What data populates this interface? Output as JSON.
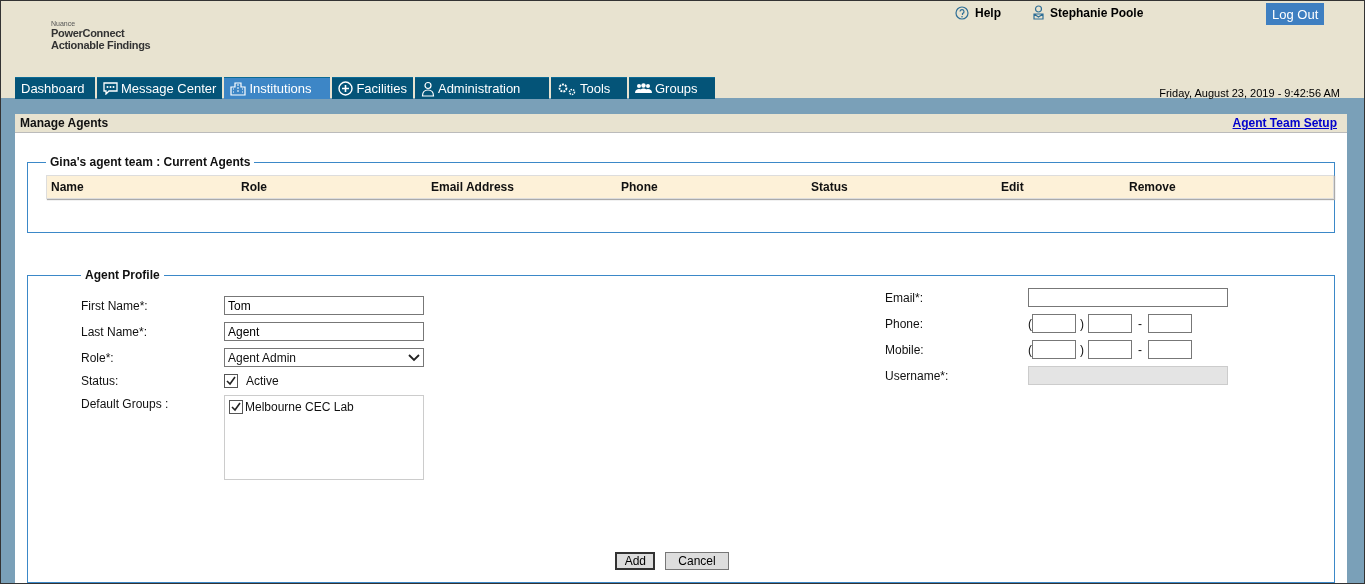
{
  "header": {
    "brand_small": "Nuance",
    "brand_line1": "PowerConnect",
    "brand_line2": "Actionable Findings",
    "help": "Help",
    "user": "Stephanie Poole",
    "logout": "Log Out",
    "datetime": "Friday, August 23, 2019 - 9:42:56 AM"
  },
  "tabs": [
    {
      "label": "Dashboard",
      "selected": false
    },
    {
      "label": "Message Center",
      "selected": false
    },
    {
      "label": "Institutions",
      "selected": true
    },
    {
      "label": "Facilities",
      "selected": false
    },
    {
      "label": "Administration",
      "selected": false
    },
    {
      "label": "Tools",
      "selected": false
    },
    {
      "label": "Groups",
      "selected": false
    }
  ],
  "page": {
    "title": "Manage Agents",
    "link": "Agent Team Setup"
  },
  "current_agents": {
    "legend": "Gina's agent team : Current Agents",
    "columns": [
      "Name",
      "Role",
      "Email Address",
      "Phone",
      "Status",
      "Edit",
      "Remove"
    ]
  },
  "profile": {
    "legend": "Agent Profile",
    "left_fields": [
      {
        "kind": "text",
        "label": "First Name*:",
        "value": "Tom"
      },
      {
        "kind": "text",
        "label": "Last Name*:",
        "value": "Agent"
      },
      {
        "kind": "select",
        "label": "Role*:",
        "value": "Agent Admin"
      },
      {
        "kind": "checkbox",
        "label": "Status:",
        "option": "Active",
        "checked": true
      },
      {
        "kind": "list",
        "label": "Default Groups :",
        "items": [
          {
            "label": "Melbourne CEC Lab",
            "checked": true
          }
        ]
      }
    ],
    "right_fields": [
      {
        "kind": "text",
        "label": "Email*:",
        "disabled": false
      },
      {
        "kind": "phone",
        "label": "Phone:",
        "open": "(",
        "close": ")",
        "dash": "-"
      },
      {
        "kind": "phone",
        "label": "Mobile:",
        "open": "(",
        "close": ")",
        "dash": "-"
      },
      {
        "kind": "text",
        "label": "Username*:",
        "disabled": true
      }
    ]
  },
  "buttons": [
    "Add",
    "Cancel"
  ]
}
